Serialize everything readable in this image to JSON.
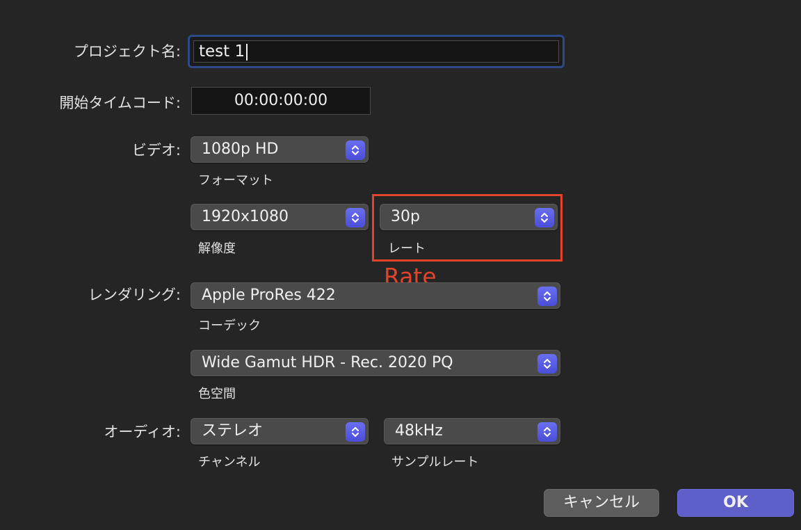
{
  "project": {
    "label": "プロジェクト名:",
    "value": "test 1"
  },
  "timecode": {
    "label": "開始タイムコード:",
    "value": "00:00:00:00"
  },
  "video": {
    "label": "ビデオ:",
    "format": {
      "value": "1080p HD",
      "caption": "フォーマット"
    },
    "resolution": {
      "value": "1920x1080",
      "caption": "解像度"
    },
    "rate": {
      "value": "30p",
      "caption": "レート"
    }
  },
  "annotation": {
    "text": "Rate",
    "color": "#e0452c"
  },
  "rendering": {
    "label": "レンダリング:",
    "codec": {
      "value": "Apple ProRes 422",
      "caption": "コーデック"
    },
    "colorspace": {
      "value": "Wide Gamut HDR - Rec. 2020 PQ",
      "caption": "色空間"
    }
  },
  "audio": {
    "label": "オーディオ:",
    "channels": {
      "value": "ステレオ",
      "caption": "チャンネル"
    },
    "samplerate": {
      "value": "48kHz",
      "caption": "サンプルレート"
    }
  },
  "buttons": {
    "cancel": "キャンセル",
    "ok": "OK"
  },
  "colors": {
    "accent": "#5e5fc9",
    "stepper": "#5a5ee6",
    "focus_ring": "#2c4a86"
  },
  "icons": {
    "stepper": "chevron-up-down-icon"
  }
}
